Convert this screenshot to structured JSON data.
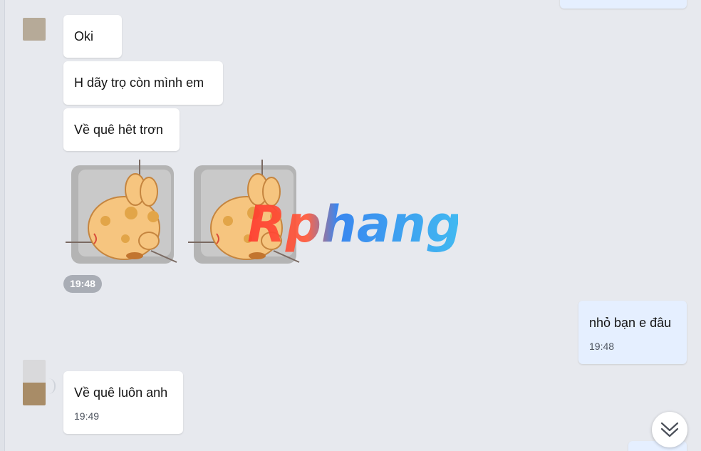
{
  "messages": {
    "m1": {
      "text": "Oki"
    },
    "m2": {
      "text": "H dãy trọ còn mình em"
    },
    "m3": {
      "text": "Về quê hêt trơn"
    },
    "sticker_group": {
      "time": "19:48"
    },
    "m4": {
      "text": "nhỏ bạn e đâu",
      "time": "19:48"
    },
    "m5": {
      "text": "Về quê luôn anh",
      "time": "19:49"
    }
  },
  "watermark": {
    "text": "Rphang"
  },
  "icons": {
    "scroll_down": "double-chevron-down-icon",
    "sticker": "hamster-sticker-icon"
  },
  "colors": {
    "background": "#e7e9ee",
    "incoming_bubble": "#ffffff",
    "outgoing_bubble": "#e5efff",
    "time_pill": "#a9adb5"
  }
}
